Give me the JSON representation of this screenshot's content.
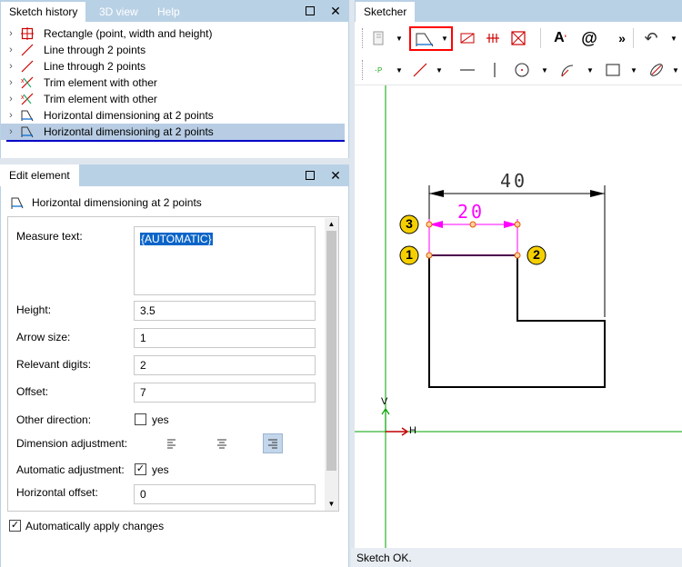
{
  "history_panel": {
    "tabs": [
      "Sketch history",
      "3D view",
      "Help"
    ],
    "items": [
      {
        "label": "Rectangle (point, width and height)",
        "icon": "rectangle-icon"
      },
      {
        "label": "Line through 2 points",
        "icon": "line-icon"
      },
      {
        "label": "Line through 2 points",
        "icon": "line-icon"
      },
      {
        "label": "Trim element with other",
        "icon": "trim-icon"
      },
      {
        "label": "Trim element with other",
        "icon": "trim-icon"
      },
      {
        "label": "Horizontal dimensioning at 2 points",
        "icon": "dimension-icon"
      },
      {
        "label": "Horizontal dimensioning at 2 points",
        "icon": "dimension-icon",
        "selected": true
      }
    ]
  },
  "edit_panel": {
    "title": "Edit element",
    "element_name": "Horizontal dimensioning at 2 points",
    "fields": {
      "measure_text_label": "Measure text:",
      "measure_text_value": "{AUTOMATIC}",
      "height_label": "Height:",
      "height_value": "3.5",
      "arrow_size_label": "Arrow size:",
      "arrow_size_value": "1",
      "relevant_digits_label": "Relevant digits:",
      "relevant_digits_value": "2",
      "offset_label": "Offset:",
      "offset_value": "7",
      "other_direction_label": "Other direction:",
      "other_direction_check": "yes",
      "dimension_adjustment_label": "Dimension adjustment:",
      "automatic_adjustment_label": "Automatic adjustment:",
      "automatic_adjustment_check": "yes",
      "horizontal_offset_label": "Horizontal offset:",
      "horizontal_offset_value": "0"
    },
    "auto_apply_label": "Automatically apply changes"
  },
  "sketcher": {
    "tab": "Sketcher",
    "toolbar_more": "»",
    "drawing": {
      "dim_40": "40",
      "dim_20": "20",
      "markers": [
        "1",
        "2",
        "3"
      ],
      "axis_v": "V",
      "axis_h": "H"
    },
    "status": "Sketch OK.",
    "colors": {
      "accent": "#ff0000",
      "dimension_pink": "#ff00ff",
      "marker_yellow": "#f5d000",
      "axis_green": "#00a000"
    }
  }
}
